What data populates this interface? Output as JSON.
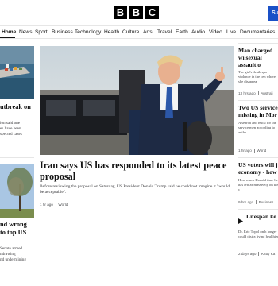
{
  "header": {
    "logo": [
      "B",
      "B",
      "C"
    ],
    "subscribe_label": "Su"
  },
  "nav": [
    "Home",
    "News",
    "Sport",
    "Business",
    "Technology",
    "Health",
    "Culture",
    "Arts",
    "Travel",
    "Earth",
    "Audio",
    "Video",
    "Live",
    "Documentaries"
  ],
  "left": {
    "story1": {
      "headline": "utbreak on",
      "summary": [
        "ion said one",
        "es have been",
        "spected cases"
      ]
    },
    "story2": {
      "headline": [
        "nd wrong",
        "to top US"
      ],
      "summary": [
        "Senate armed",
        "ndrawing",
        "nd undermining"
      ]
    }
  },
  "main": {
    "headline": "Iran says US has responded to its latest peace proposal",
    "summary": "Before reviewing the proposal on Saturday, US President Donald Trump said he could not imagine it \"would be acceptable\".",
    "time": "1 hr ago",
    "tag": "World"
  },
  "right": [
    {
      "headline": "Man charged wi sexual assault o Australian girl",
      "summary": "The girl's death spa violence in the cen where she disappea",
      "time": "13 hrs ago",
      "tag": "Australi",
      "live": false
    },
    {
      "headline": "Two US service missing in Mor",
      "summary": "A search and rescu for the service men according to autho",
      "time": "1 hr ago",
      "tag": "World",
      "live": false
    },
    {
      "headline": "US voters will j economy - how",
      "summary": "How much Donald time he has left as massively on the c",
      "time": "9 hrs ago",
      "tag": "Business",
      "live": false
    },
    {
      "headline": "Lifespan ke healthspan ma",
      "summary": "Dr. Eric Topol on h longer could distra living healthier.",
      "time": "2 days ago",
      "tag": "Katty Ka",
      "live": true
    }
  ],
  "colors": {
    "accent": "#1a50c7",
    "text": "#141414"
  }
}
